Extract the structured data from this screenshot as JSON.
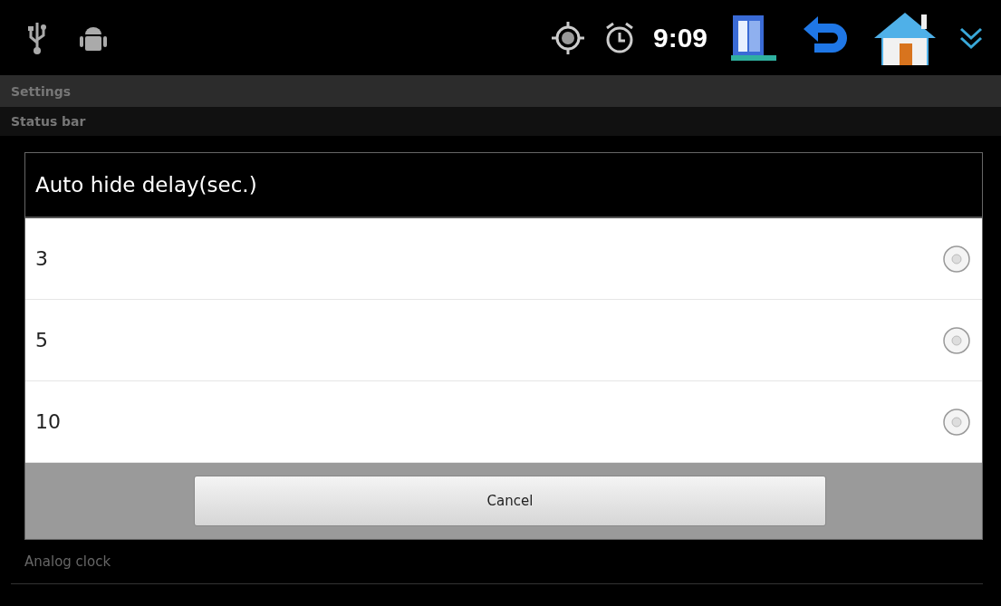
{
  "status_bar": {
    "time": "9:09"
  },
  "title_bar": {
    "title": "Settings"
  },
  "section_header": "Status bar",
  "background_items": [
    {
      "summary": "Analog clock"
    }
  ],
  "dialog": {
    "title": "Auto hide delay(sec.)",
    "options": [
      {
        "label": "3",
        "selected": false
      },
      {
        "label": "5",
        "selected": false
      },
      {
        "label": "10",
        "selected": false
      }
    ],
    "buttons": [
      "Cancel"
    ]
  }
}
